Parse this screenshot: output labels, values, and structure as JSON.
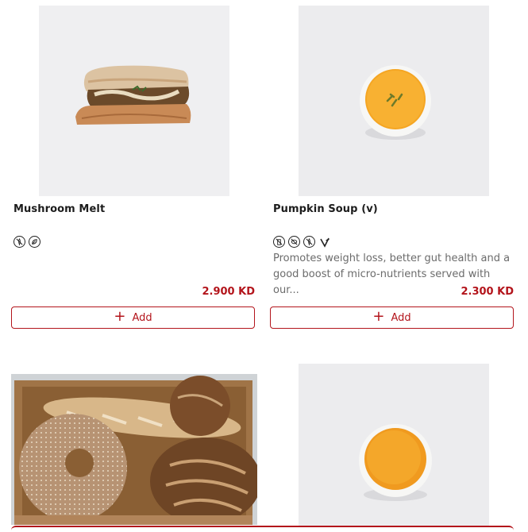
{
  "products": [
    {
      "name": "Mushroom Melt",
      "description": "",
      "price": "2.900 KD",
      "add_label": "Add",
      "badges": [
        "no-gluten-icon",
        "vegetarian-leaf-icon"
      ]
    },
    {
      "name": "Pumpkin Soup (v)",
      "description_line1": "Promotes weight loss, better gut health and a",
      "description_line2": "good boost of micro-nutrients served with our...",
      "price": "2.300 KD",
      "add_label": "Add",
      "badges": [
        "no-dairy-icon",
        "no-nuts-icon",
        "no-gluten-icon",
        "vegan-sprout-icon"
      ]
    },
    {
      "name": "",
      "image": "bread-basket"
    },
    {
      "name": "",
      "image": "soup-bowl"
    }
  ],
  "colors": {
    "accent": "#b3141b",
    "image_bg": "#efeff0"
  }
}
